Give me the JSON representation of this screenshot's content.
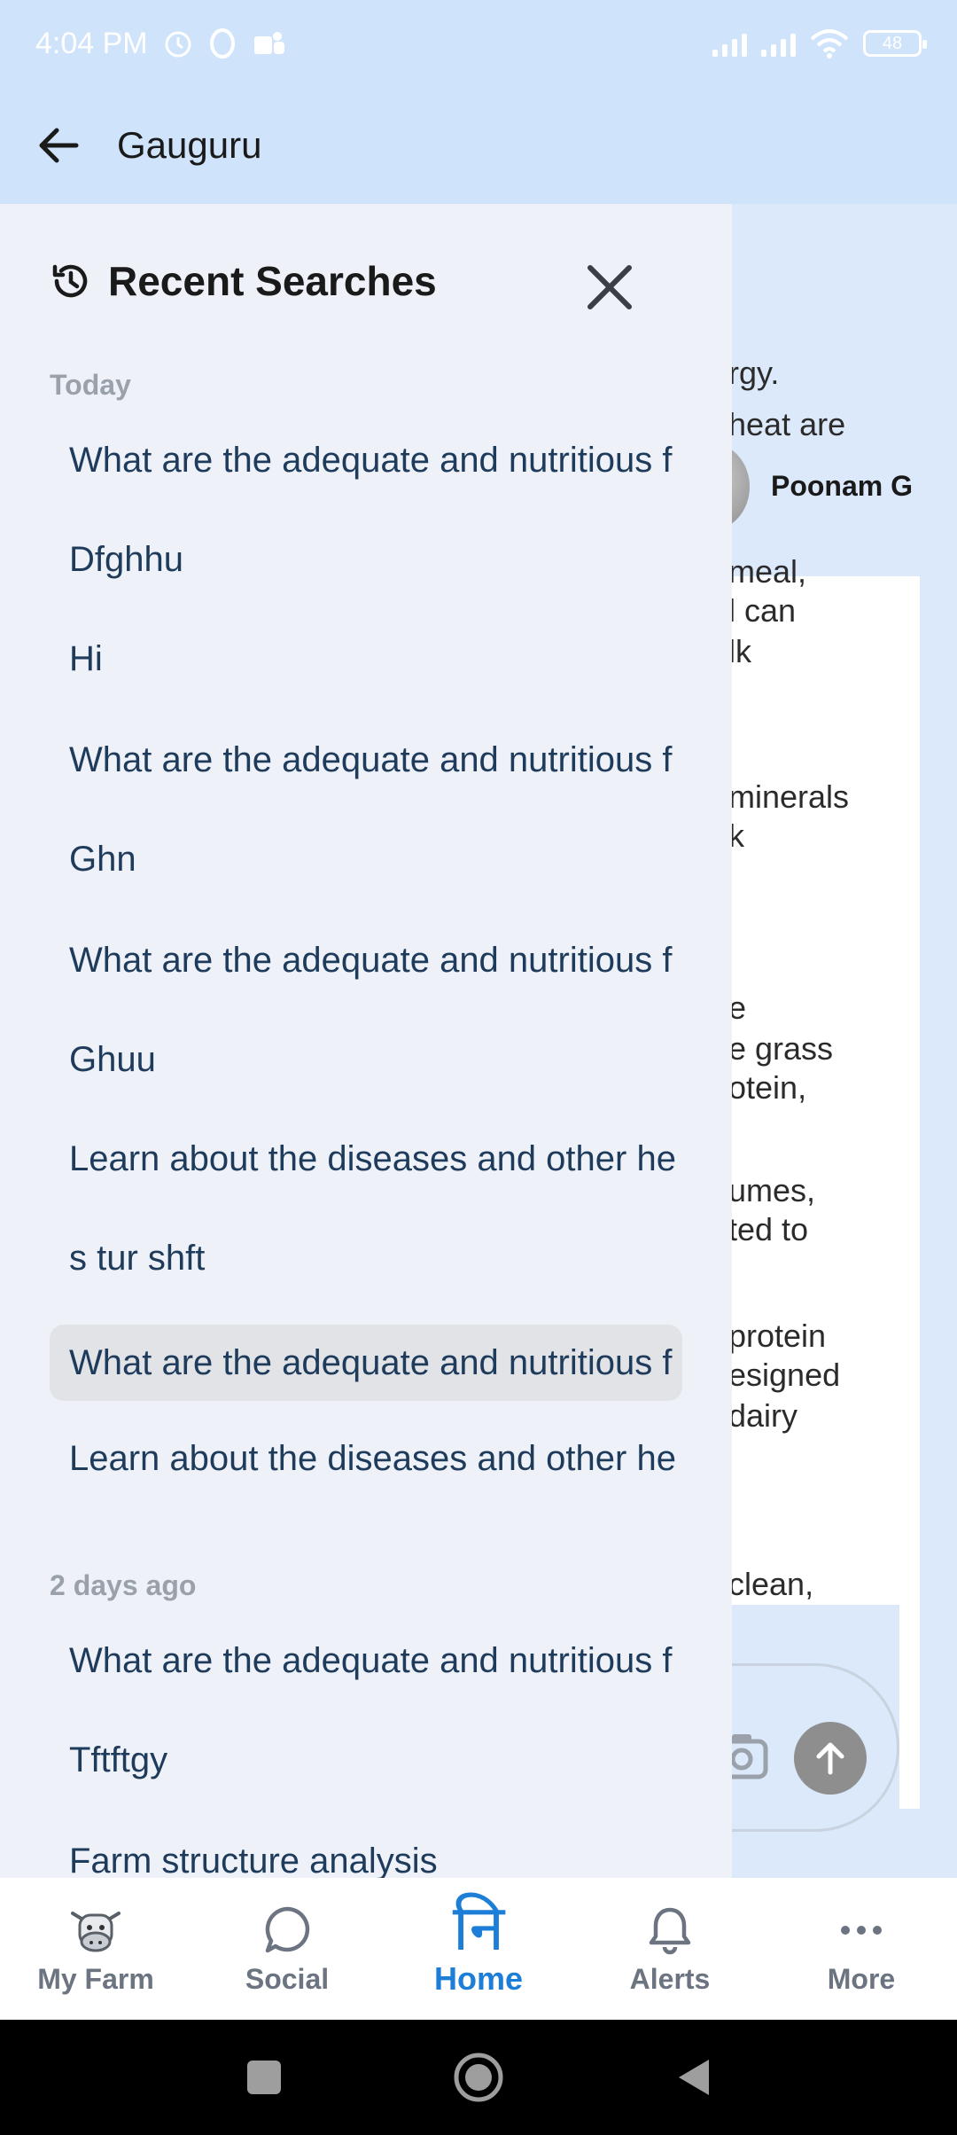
{
  "status_bar": {
    "time": "4:04 PM",
    "battery": "48"
  },
  "app_bar": {
    "title": "Gauguru"
  },
  "background": {
    "user_name": "Poonam G",
    "lines": [
      "rgy.",
      "heat are",
      "meal,",
      "l can",
      "lk",
      "minerals",
      "k",
      "e",
      "e grass",
      "otein,",
      "umes,",
      "ted to",
      "protein",
      "esigned",
      "dairy",
      "clean,"
    ]
  },
  "drawer": {
    "title": "Recent Searches",
    "sections": [
      {
        "label": "Today",
        "items": [
          "What are the adequate and nutritious f",
          "Dfghhu",
          "Hi",
          "What are the adequate and nutritious f",
          "Ghn",
          "What are the adequate and nutritious f",
          "Ghuu",
          "Learn about the diseases and other he",
          "s tur shft",
          "What are the adequate and nutritious f",
          "Learn about the diseases and other he"
        ]
      },
      {
        "label": "2 days ago",
        "items": [
          "What are the adequate and nutritious f",
          "Tftftgy",
          "Farm structure analysis"
        ]
      }
    ]
  },
  "bottom_nav": {
    "items": [
      {
        "label": "My Farm",
        "icon": "cow-icon"
      },
      {
        "label": "Social",
        "icon": "chat-bubble-icon"
      },
      {
        "label": "Home",
        "icon": "home-devanagari-icon",
        "glyph": "नि"
      },
      {
        "label": "Alerts",
        "icon": "bell-icon"
      },
      {
        "label": "More",
        "icon": "more-dots-icon"
      }
    ]
  },
  "colors": {
    "app_bar": "#cfe3fb",
    "drawer_bg": "#eef2f8",
    "item_text": "#1f3b5c",
    "active_nav": "#1c7ed6",
    "selected_item_bg": "#e1e3e7"
  }
}
